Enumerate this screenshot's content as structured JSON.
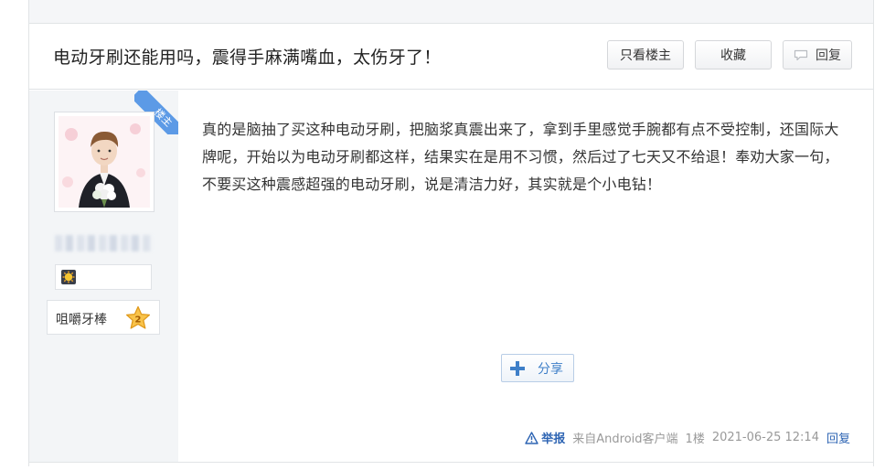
{
  "thread": {
    "title": "电动牙刷还能用吗，震得手麻满嘴血，太伤牙了！",
    "buttons": {
      "only_op": "只看楼主",
      "favorite": "收藏",
      "reply": "回复"
    }
  },
  "author": {
    "op_tag": "楼主",
    "level_name": "咀嚼牙棒",
    "level": "2",
    "avatar_icon": "user-avatar-photo",
    "badge_icon": "sun-badge-icon"
  },
  "post": {
    "content": "真的是脑抽了买这种电动牙刷，把脑浆真震出来了，拿到手里感觉手腕都有点不受控制，还国际大牌呢，开始以为电动牙刷都这样，结果实在是用不习惯，然后过了七天又不给退！奉劝大家一句，不要买这种震感超强的电动牙刷，说是清洁力好，其实就是个小电钻！",
    "share_label": "分享",
    "report_label": "举报",
    "source": "来自Android客户端",
    "floor": "1楼",
    "time": "2021-06-25 12:14",
    "reply_label": "回复"
  },
  "colors": {
    "link": "#2d64b3",
    "ribbon": "#5c9ae6",
    "share": "#3e7fc8",
    "sidebar_bg": "#f3f5f7"
  }
}
